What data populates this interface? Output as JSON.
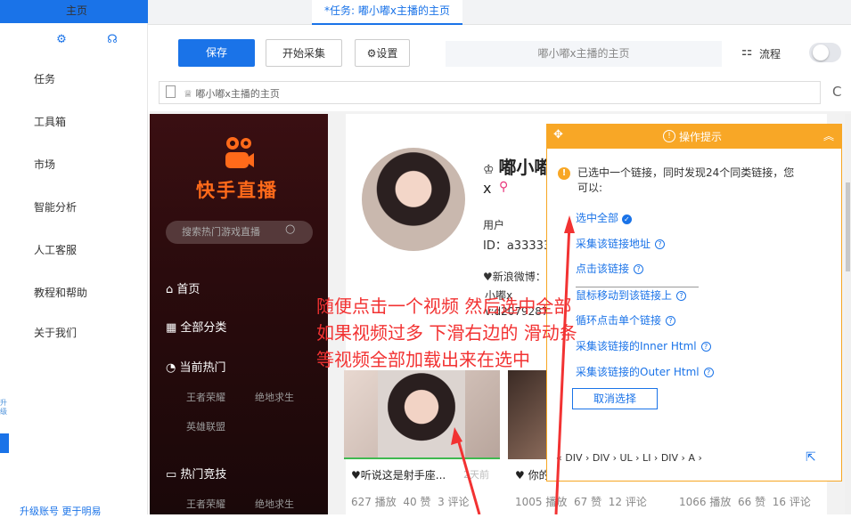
{
  "sidebar": {
    "icons": [
      "gear-icon",
      "headset-icon"
    ],
    "items": [
      {
        "label": "任务"
      },
      {
        "label": "工具箱"
      },
      {
        "label": "市场"
      },
      {
        "label": "智能分析"
      },
      {
        "label": "人工客服"
      },
      {
        "label": "教程和帮助"
      },
      {
        "label": "关于我们"
      }
    ],
    "edge_text": "升级",
    "bottom_links": "升级账号   更于明易"
  },
  "tabs": [
    {
      "label": "主页"
    },
    {
      "label": "*任务: 嘟小嘟x主播的主页"
    }
  ],
  "toolbar": {
    "save": "保存",
    "start_collect": "开始采集",
    "settings": "设置",
    "page_title": "嘟小嘟x主播的主页",
    "flow": "流程"
  },
  "address": "嘟小嘟x主播的主页",
  "kuaishou": {
    "brand": "快手直播",
    "search_placeholder": "搜索热门游戏直播",
    "nav": [
      {
        "label": "首页"
      },
      {
        "label": "全部分类"
      },
      {
        "label": "当前热门"
      },
      {
        "label": "热门竞技"
      }
    ],
    "hot_games": [
      "王者荣耀",
      "绝地求生",
      "英雄联盟"
    ],
    "comp_games": [
      "王者荣耀",
      "绝地求生"
    ]
  },
  "profile": {
    "name": "嘟小嘟",
    "name_suffix": "x",
    "user_label": "用户",
    "user_id": "ID：a33333",
    "weibo": "♥新浪微博：",
    "line2": "小嘟x",
    "line3": "v:d2079287"
  },
  "videos": [
    {
      "title": "♥听说这是射手座...",
      "time": "2天前",
      "plays": "627 播放",
      "likes": "40 赞",
      "comments": "3 评论"
    },
    {
      "title": "♥ 你的",
      "plays": "1005 播放",
      "likes": "67 赞",
      "comments": "12 评论"
    },
    {
      "plays": "1066 播放",
      "likes": "66 赞",
      "comments": "16 评论"
    }
  ],
  "annotation": [
    "随便点击一个视频 然后选中全部",
    "如果视频过多 下滑右边的 滑动条",
    "等视频全部加载出来在选中"
  ],
  "popup": {
    "title": "操作提示",
    "message": "已选中一个链接，同时发现24个同类链接，您可以:",
    "options": [
      "选中全部",
      "采集该链接地址",
      "点击该链接",
      "鼠标移动到该链接上",
      "循环点击单个链接",
      "采集该链接的Inner Html",
      "采集该链接的Outer Html"
    ],
    "cancel": "取消选择",
    "breadcrumb": "«  DIV  ›  DIV  ›  UL  ›  LI  ›  DIV  ›  A  ›"
  },
  "colors": {
    "accent": "#1a73e8",
    "popup": "#f8a726",
    "annotation": "#f23232",
    "brand": "#ff6a1a"
  }
}
